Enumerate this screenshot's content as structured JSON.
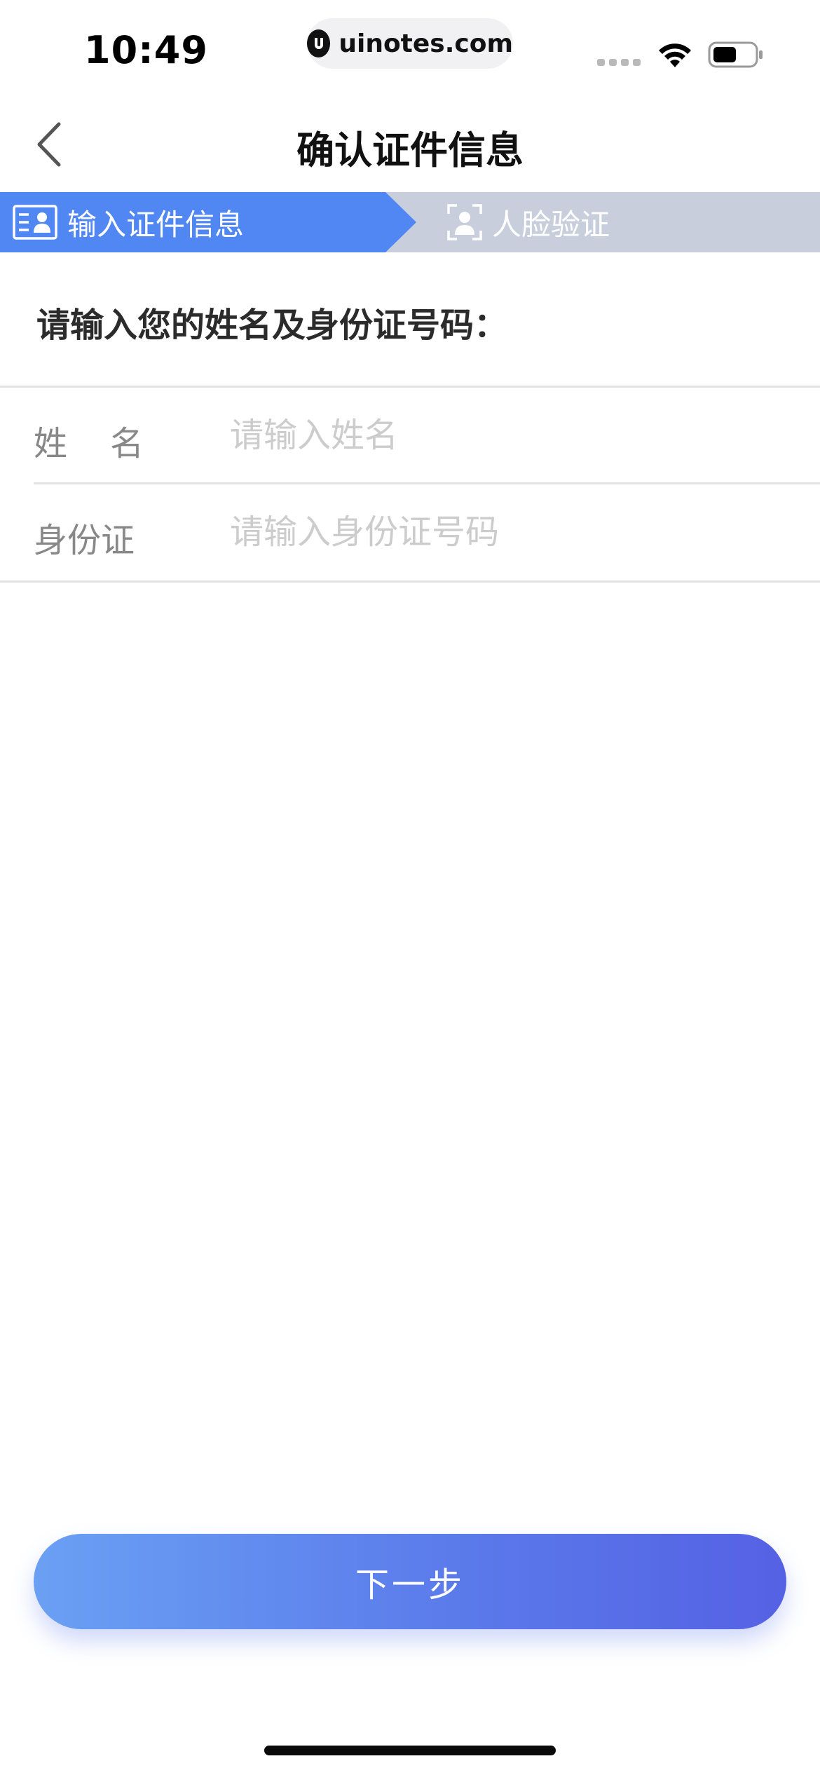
{
  "status_bar": {
    "time": "10:49",
    "url": "uinotes.com",
    "icons": [
      "signal-dots-icon",
      "wifi-icon",
      "battery-icon"
    ]
  },
  "nav": {
    "title": "确认证件信息",
    "back_icon": "chevron-left-icon"
  },
  "steps": [
    {
      "label": "输入证件信息",
      "icon": "id-card-icon",
      "active": true
    },
    {
      "label": "人脸验证",
      "icon": "face-scan-icon",
      "active": false
    }
  ],
  "prompt": "请输入您的姓名及身份证号码：",
  "form": {
    "name": {
      "label": "姓    名",
      "placeholder": "请输入姓名",
      "value": ""
    },
    "id_number": {
      "label": "身份证",
      "placeholder": "请输入身份证号码",
      "value": ""
    }
  },
  "next_button": {
    "label": "下一步"
  },
  "colors": {
    "step_active": "#5087f3",
    "step_inactive": "#c8cedc",
    "button_start": "#6aa0f4",
    "button_end": "#5561e4"
  }
}
